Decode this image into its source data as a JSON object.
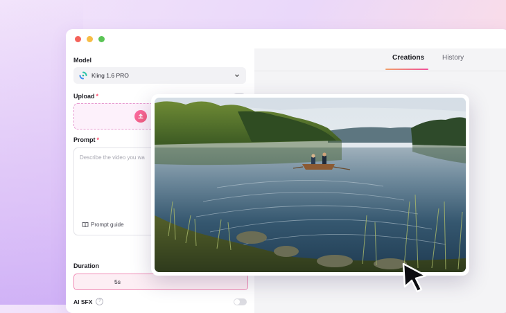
{
  "window": {
    "controls": [
      "close",
      "minimize",
      "maximize"
    ]
  },
  "form": {
    "model": {
      "label": "Model",
      "value": "Kling 1.6 PRO",
      "logo": "kling-logo-icon"
    },
    "upload": {
      "label": "Upload",
      "required_mark": "*",
      "icon": "upload-icon"
    },
    "prompt": {
      "label": "Prompt",
      "required_mark": "*",
      "placeholder": "Describe the video you wa",
      "guide_label": "Prompt guide"
    },
    "duration": {
      "label": "Duration",
      "selected": "5s"
    },
    "ai_sfx": {
      "label": "AI SFX",
      "enabled": false
    }
  },
  "tabs": [
    {
      "label": "Creations",
      "active": true
    },
    {
      "label": "History",
      "active": false
    }
  ],
  "preview": {
    "icon": "lake-rowboat-photo"
  },
  "colors": {
    "accent_pink": "#f04f9a",
    "accent_orange": "#f0a06a",
    "required": "#ff4d6d"
  }
}
